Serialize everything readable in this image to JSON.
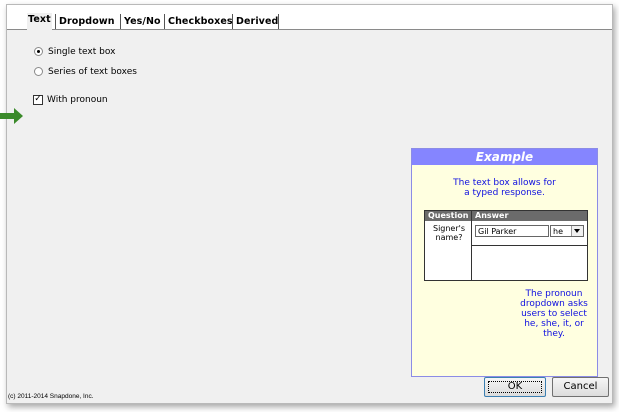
{
  "tabs": [
    {
      "label": "Text",
      "active": true
    },
    {
      "label": "Dropdown",
      "active": false
    },
    {
      "label": "Yes/No",
      "active": false
    },
    {
      "label": "Checkboxes",
      "active": false
    },
    {
      "label": "Derived",
      "active": false
    }
  ],
  "options": {
    "single_text_box": "Single text box",
    "series_of_text_boxes": "Series of text boxes",
    "with_pronoun": "With pronoun"
  },
  "example": {
    "title": "Example",
    "description_line1": "The text box allows for",
    "description_line2": "a typed response.",
    "table": {
      "col_question": "Question",
      "col_answer": "Answer",
      "question_line1": "Signer's",
      "question_line2": "name?",
      "answer_value": "Gil Parker",
      "pronoun_value": "he"
    },
    "note_line1": "The pronoun",
    "note_line2": "dropdown asks",
    "note_line3": "users to select",
    "note_line4": "he, she, it, or",
    "note_line5": "they."
  },
  "footer": {
    "copyright": "(c) 2011-2014 Snapdone, Inc.",
    "ok_label": "OK",
    "cancel_label": "Cancel"
  },
  "colors": {
    "example_header": "#8585ff",
    "example_bg": "#ffffe0",
    "example_text": "#1010e0",
    "arrow": "#3a8a2a"
  }
}
